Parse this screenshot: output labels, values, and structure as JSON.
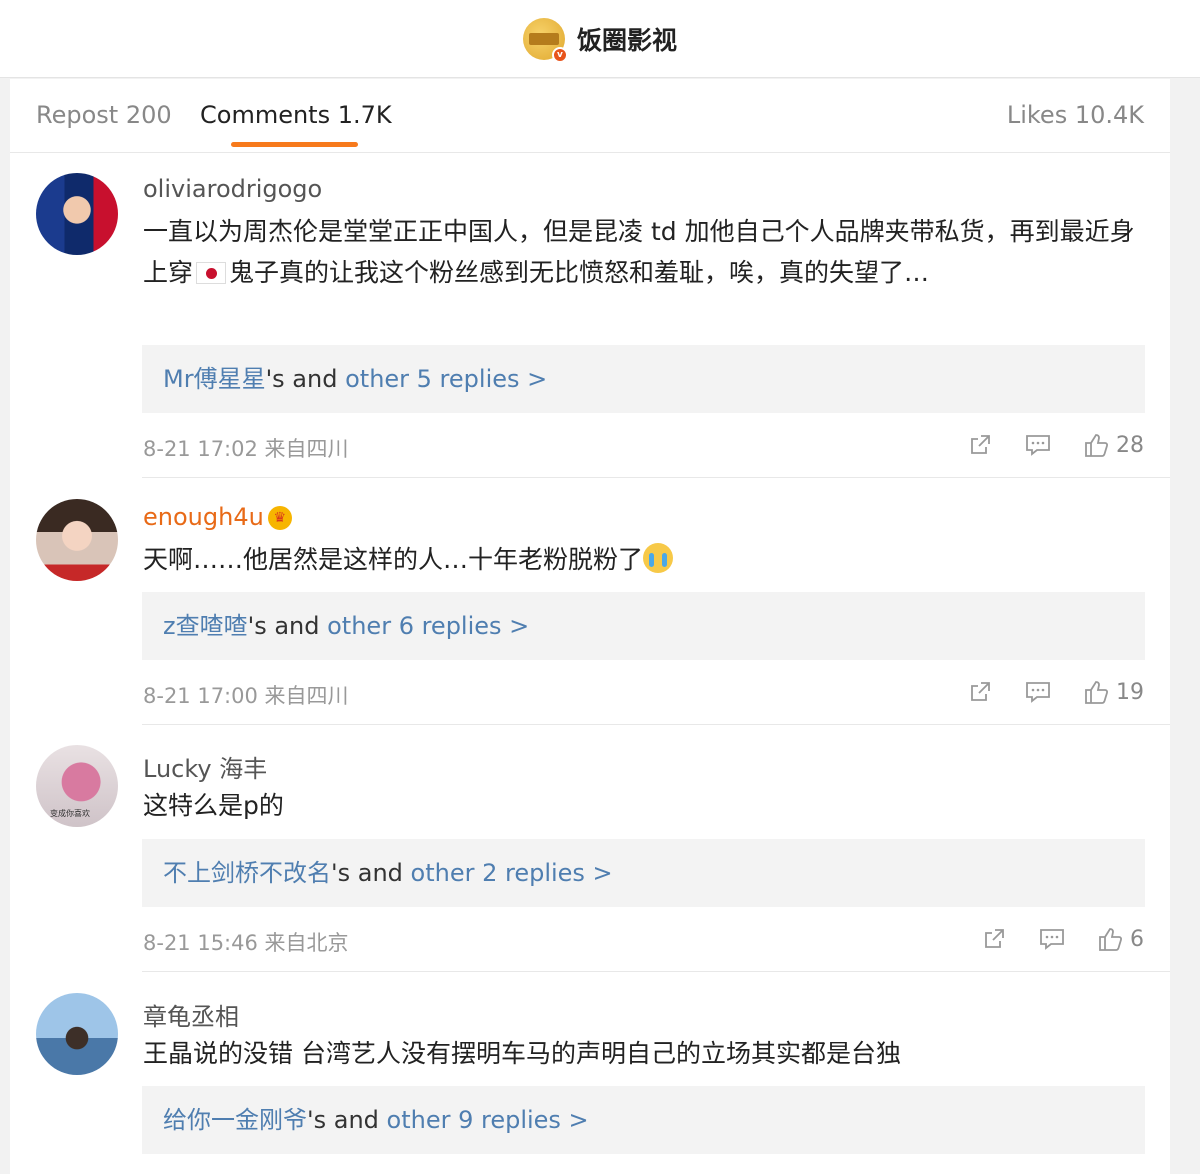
{
  "header": {
    "account_name": "饭圈影视"
  },
  "tabs": {
    "repost": "Repost 200",
    "comments": "Comments 1.7K",
    "likes": "Likes 10.4K"
  },
  "comments": [
    {
      "username": "oliviarodrigogo",
      "text_part1": "一直以为周杰伦是堂堂正正中国人，但是昆凌 td 加他自己个人品牌夹带私货，再到最近身上穿",
      "text_part2": "鬼子真的让我这个粉丝感到无比愤怒和羞耻，唉，真的失望了…",
      "reply_user": "Mr傅星星",
      "reply_mid": "'s and ",
      "reply_more": "other 5 replies >",
      "meta": "8-21 17:02  来自四川",
      "likes": "28"
    },
    {
      "username": "enough4u",
      "text": "天啊……他居然是这样的人…十年老粉脱粉了",
      "reply_user": "z查喳喳",
      "reply_mid": "'s and ",
      "reply_more": "other 6 replies >",
      "meta": "8-21 17:00  来自四川",
      "likes": "19"
    },
    {
      "username": "Lucky 海丰",
      "avatar_caption": "变成你喜欢",
      "text": "这特么是p的",
      "reply_user": "不上剑桥不改名",
      "reply_mid": "'s and ",
      "reply_more": "other 2 replies >",
      "meta": "8-21 15:46  来自北京",
      "likes": "6"
    },
    {
      "username": "章龟丞相",
      "text": "王晶说的没错 台湾艺人没有摆明车马的声明自己的立场其实都是台独",
      "reply_user": "给你一金刚爷",
      "reply_mid": "'s and ",
      "reply_more": "other 9 replies >"
    }
  ],
  "colors": {
    "accent_orange": "#f77a1c",
    "link_blue": "#4f7eb0",
    "vip_orange": "#e86a17"
  }
}
